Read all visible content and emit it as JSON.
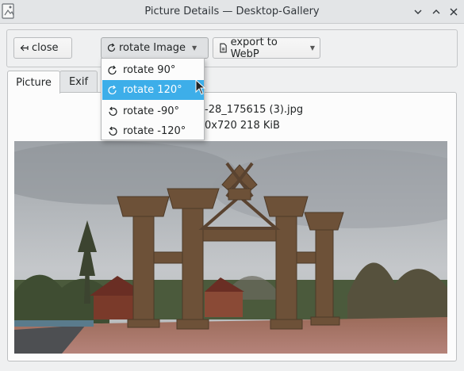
{
  "window": {
    "title": "Picture Details — Desktop-Gallery"
  },
  "titlebar_icons": [
    "app-icon",
    "chevron-down-icon",
    "chevron-up-icon",
    "close-icon"
  ],
  "toolbar": {
    "close_label": "close",
    "rotate_label": "rotate Image",
    "export_label": "export to WebP"
  },
  "rotate_menu": {
    "items": [
      {
        "label": "rotate 90°",
        "icon": "rotate-clockwise-icon"
      },
      {
        "label": "rotate 120°",
        "icon": "rotate-clockwise-icon",
        "selected": true
      },
      {
        "label": "rotate -90°",
        "icon": "rotate-counterclockwise-icon"
      },
      {
        "label": "rotate -120°",
        "icon": "rotate-counterclockwise-icon"
      }
    ]
  },
  "tabs": [
    {
      "label": "Picture",
      "active": true
    },
    {
      "label": "Exif",
      "active": false
    }
  ],
  "picture": {
    "filename_visible": "-28_175615 (3).jpg",
    "meta_visible": "0x720 218 KiB"
  },
  "colors": {
    "accent": "#3daee9",
    "window_bg": "#eff0f1"
  }
}
